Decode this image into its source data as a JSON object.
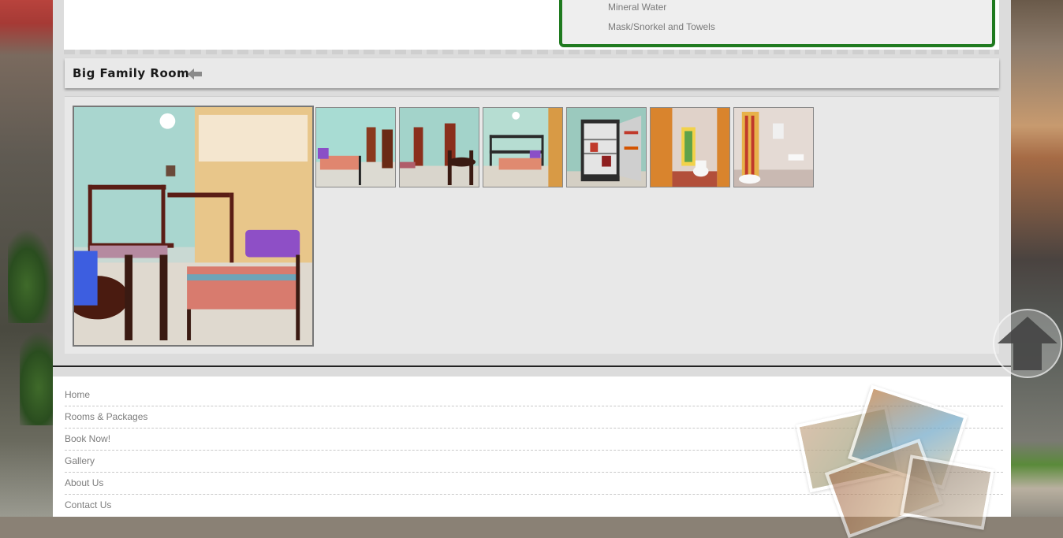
{
  "amenities": {
    "items": [
      "Mineral Water",
      "Mask/Snorkel and Towels"
    ]
  },
  "room": {
    "title": "Big Family Room",
    "back_icon": "back-arrow-icon",
    "photos": [
      {
        "name": "room-photo-main",
        "scene": "bedroom-bunk"
      },
      {
        "name": "room-photo-thumb-1",
        "scene": "bedroom-aqua"
      },
      {
        "name": "room-photo-thumb-2",
        "scene": "dining-corner"
      },
      {
        "name": "room-photo-thumb-3",
        "scene": "bunk-beds"
      },
      {
        "name": "room-photo-thumb-4",
        "scene": "refrigerator"
      },
      {
        "name": "room-photo-thumb-5",
        "scene": "bathroom-toilet"
      },
      {
        "name": "room-photo-thumb-6",
        "scene": "bathroom-shower"
      }
    ]
  },
  "footer": {
    "links": [
      "Home",
      "Rooms & Packages",
      "Book Now!",
      "Gallery",
      "About Us",
      "Contact Us"
    ]
  },
  "scroll_top": {
    "icon": "up-arrow-icon"
  },
  "colors": {
    "accent_green": "#1f7a1f",
    "panel": "#e8e8e8",
    "link_text": "#7d7d7d"
  }
}
